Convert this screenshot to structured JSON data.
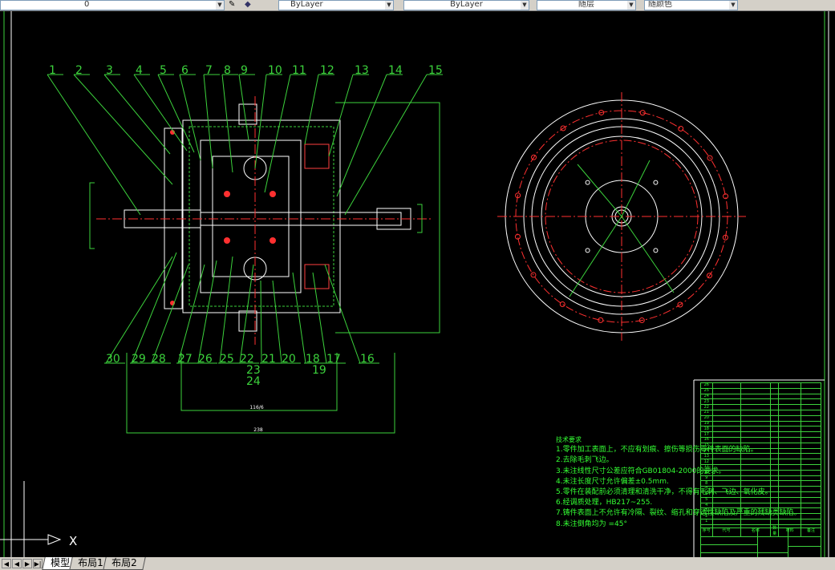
{
  "toolbar": {
    "layer": "0",
    "color": "ByLayer",
    "linetype": "ByLayer",
    "lineweight": "随层",
    "plotstyle": "随颜色"
  },
  "drawing": {
    "balloons_top": [
      "1",
      "2",
      "3",
      "4",
      "5",
      "6",
      "7",
      "8",
      "9",
      "10",
      "11",
      "12",
      "13",
      "14",
      "15"
    ],
    "balloons_bottom": [
      "30",
      "29",
      "28",
      "27",
      "26",
      "25",
      "22",
      "21",
      "20",
      "18",
      "17",
      "16"
    ],
    "balloons_stacked": [
      "23",
      "24",
      "19"
    ],
    "dim_inner": "116/6",
    "dim_outer": "238"
  },
  "tech_requirements": {
    "title": "技术要求",
    "items": [
      "1.零件加工表面上，不应有划痕、擦伤等损伤零件表面的缺陷。",
      "2.去除毛刺飞边。",
      "3.未注线性尺寸公差应符合GB01804-2000的要求。",
      "4.未注长度尺寸允许偏差±0.5mm.",
      "5.零件在装配前必须清理和清洗干净，不得有毛刺、飞边、氧化皮。",
      "6.经调质处理，HB217~255.",
      "7.铸件表面上不允许有冷隔、裂纹、缩孔和穿透性缺陷及严重的残缺类缺陷。",
      "8.未注倒角均为 =45°"
    ]
  },
  "parts_list": {
    "row_numbers": [
      "26",
      "25",
      "24",
      "23",
      "22",
      "21",
      "20",
      "19",
      "18",
      "17",
      "16",
      "15",
      "14",
      "13",
      "12",
      "11",
      "10",
      "9",
      "8",
      "7",
      "6",
      "5",
      "4",
      "3",
      "2",
      "1"
    ],
    "header": [
      "序号",
      "代号",
      "名称",
      "数量",
      "材料",
      "备注"
    ]
  },
  "ucs": {
    "x_label": "X"
  },
  "tabs": {
    "model": "模型",
    "layout1": "布局1",
    "layout2": "布局2"
  },
  "colors": {
    "background": "#000000",
    "green": "#00ff00",
    "red": "#ff0000",
    "white": "#ffffff",
    "line_green": "#3cd23c"
  }
}
